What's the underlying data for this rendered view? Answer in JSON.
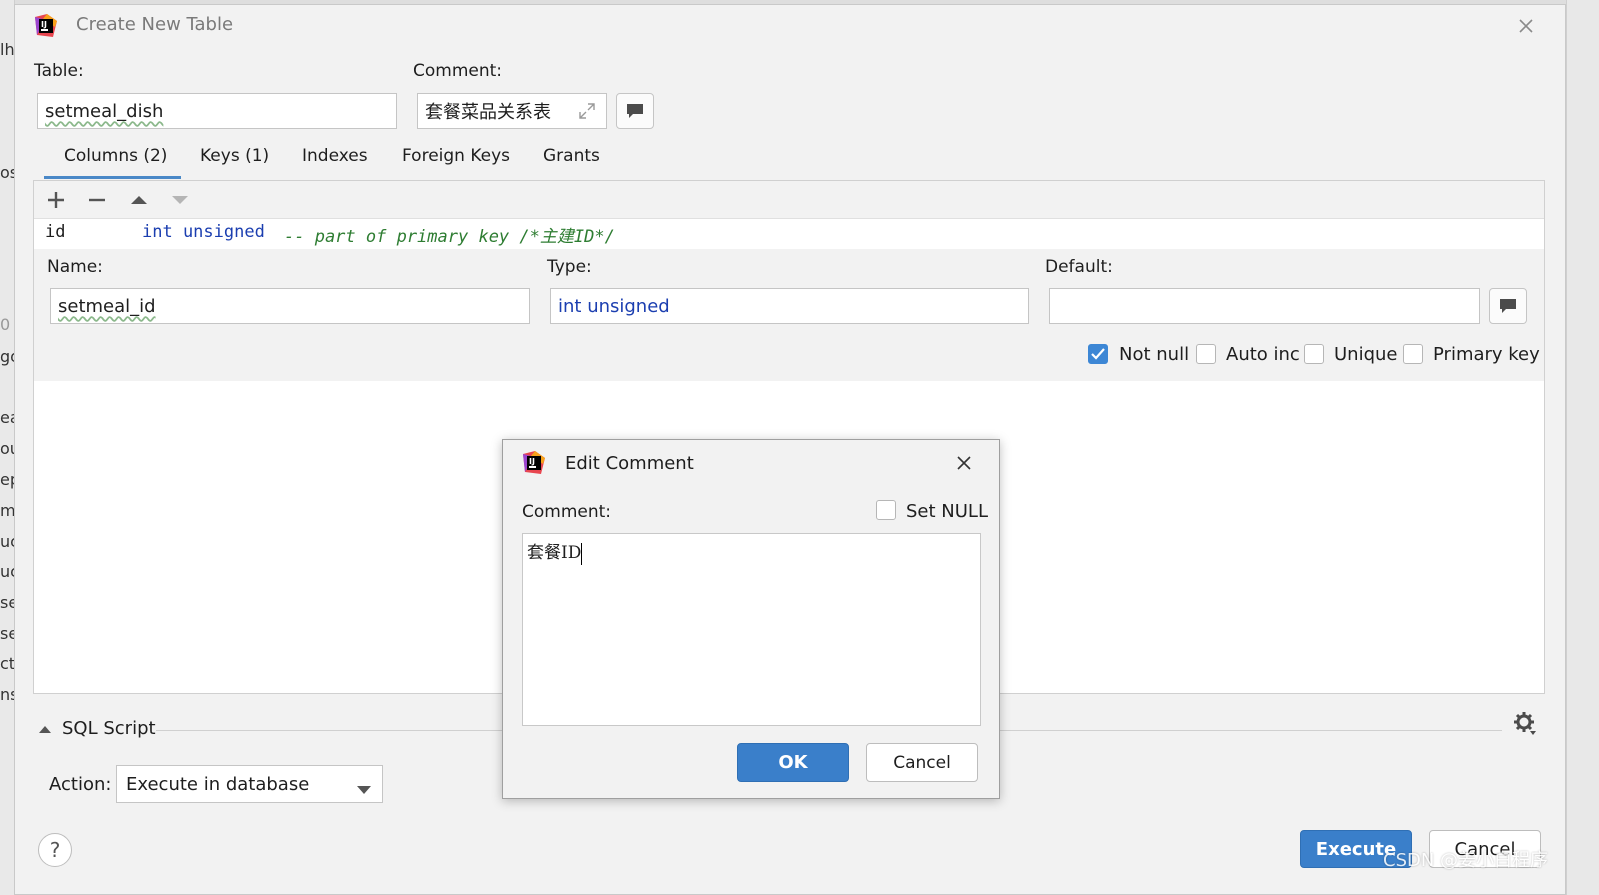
{
  "dialog": {
    "title": "Create New Table",
    "table_label": "Table:",
    "table_value": "setmeal_dish",
    "comment_label": "Comment:",
    "comment_value": "套餐菜品关系表",
    "tabs": [
      {
        "label": "Columns (2)",
        "active": true
      },
      {
        "label": "Keys (1)"
      },
      {
        "label": "Indexes"
      },
      {
        "label": "Foreign Keys"
      },
      {
        "label": "Grants"
      }
    ],
    "column_row": {
      "name": "id",
      "type": "int unsigned",
      "comment": "-- part of primary key /*主建ID*/"
    },
    "editor": {
      "name_label": "Name:",
      "name_value": "setmeal_id",
      "type_label": "Type:",
      "type_value": "int unsigned",
      "default_label": "Default:",
      "default_value": "",
      "checkboxes": [
        {
          "label": "Not null",
          "checked": true
        },
        {
          "label": "Auto inc",
          "checked": false
        },
        {
          "label": "Unique",
          "checked": false
        },
        {
          "label": "Primary key",
          "checked": false
        }
      ]
    },
    "sql_script_label": "SQL Script",
    "action_label": "Action:",
    "action_value": "Execute in database",
    "execute_label": "Execute",
    "cancel_label": "Cancel",
    "help_glyph": "?"
  },
  "modal": {
    "title": "Edit Comment",
    "comment_label": "Comment:",
    "set_null_label": "Set NULL",
    "set_null_checked": false,
    "text_value": "套餐ID",
    "ok_label": "OK",
    "cancel_label": "Cancel"
  },
  "background_fragments": [
    "lh",
    "os",
    "0",
    "go",
    "ea",
    "ou",
    "ep",
    "mp",
    "uc",
    "uc",
    "se",
    "se",
    "ct",
    "ns"
  ],
  "watermark": "CSDN @姜小白程序",
  "colors": {
    "accent": "#3a7fca",
    "tab_underline": "#4a88c7",
    "type_blue": "#1b3eb0",
    "comment_green": "#2e7d32"
  },
  "icons": [
    "jetbrains-logo-icon",
    "close-icon",
    "expand-icon",
    "comment-icon",
    "add-icon",
    "remove-icon",
    "move-up-icon",
    "move-down-icon",
    "collapse-arrow-icon",
    "gear-icon",
    "dropdown-arrow-icon",
    "checkmark-icon",
    "help-icon"
  ]
}
